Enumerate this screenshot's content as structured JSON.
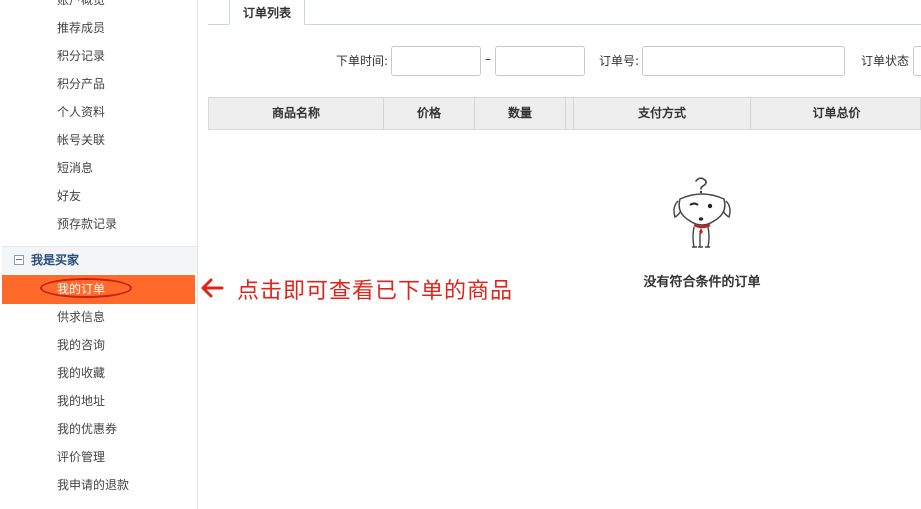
{
  "sidebar": {
    "items_top": [
      "账户概览",
      "推荐成员",
      "积分记录",
      "积分产品",
      "个人资料",
      "帐号关联",
      "短消息",
      "好友",
      "预存款记录"
    ],
    "group_title": "我是买家",
    "active_item": "我的订单",
    "items_bottom": [
      "供求信息",
      "我的咨询",
      "我的收藏",
      "我的地址",
      "我的优惠券",
      "评价管理",
      "我申请的退款"
    ]
  },
  "annotation": {
    "text": "点击即可查看已下单的商品",
    "color": "#e2231a"
  },
  "tabs": [
    {
      "label": "订单列表"
    }
  ],
  "filters": {
    "order_time_label": "下单时间:",
    "date_separator": "–",
    "order_no_label": "订单号:",
    "order_status_label": "订单状态",
    "order_time_start_value": "",
    "order_time_end_value": "",
    "order_no_value": ""
  },
  "table": {
    "columns": [
      "商品名称",
      "价格",
      "数量",
      "",
      "支付方式",
      "订单总价"
    ]
  },
  "empty_state": {
    "message": "没有符合条件的订单",
    "icon": "confused-dog-icon"
  },
  "colors": {
    "active_bg": "#ff6a2b",
    "group_title": "#2b4d7c",
    "annotation": "#e2231a"
  }
}
